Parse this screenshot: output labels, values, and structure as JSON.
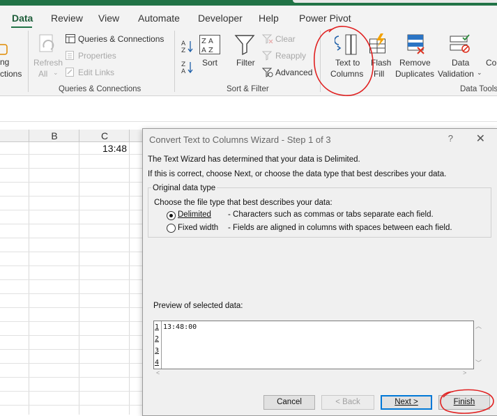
{
  "tabs": [
    "Data",
    "Review",
    "View",
    "Automate",
    "Developer",
    "Help",
    "Power Pivot"
  ],
  "ribbon": {
    "partial_left": {
      "line1": "ng",
      "line2": "ctions"
    },
    "refresh": {
      "line1": "Refresh",
      "line2": "All"
    },
    "queries_connections": "Queries & Connections",
    "properties": "Properties",
    "edit_links": "Edit Links",
    "group_queries": "Queries & Connections",
    "sort": "Sort",
    "filter": "Filter",
    "clear": "Clear",
    "reapply": "Reapply",
    "advanced": "Advanced",
    "group_sort_filter": "Sort & Filter",
    "text_to_columns": {
      "line1": "Text to",
      "line2": "Columns"
    },
    "flash_fill": {
      "line1": "Flash",
      "line2": "Fill"
    },
    "remove_duplicates": {
      "line1": "Remove",
      "line2": "Duplicates"
    },
    "data_validation": {
      "line1": "Data",
      "line2": "Validation"
    },
    "partial_right": "Co",
    "group_data_tools": "Data Tools"
  },
  "sheet": {
    "columns": [
      "B",
      "C"
    ],
    "cell_c1": "13:48"
  },
  "dialog": {
    "title": "Convert Text to Columns Wizard - Step 1 of 3",
    "help": "?",
    "close": "✕",
    "line1": "The Text Wizard has determined that your data is Delimited.",
    "line2": "If this is correct, choose Next, or choose the data type that best describes your data.",
    "group_label": "Original data type",
    "choose_text": "Choose the file type that best describes your data:",
    "options": [
      {
        "label": "Delimited",
        "desc": "- Characters such as commas or tabs separate each field.",
        "selected": true
      },
      {
        "label": "Fixed width",
        "desc": "- Fields are aligned in columns with spaces between each field.",
        "selected": false
      }
    ],
    "preview_label": "Preview of selected data:",
    "preview_rows": [
      "1",
      "2",
      "3",
      "4"
    ],
    "preview_line1": "13:48:00",
    "buttons": {
      "cancel": "Cancel",
      "back": "< Back",
      "next": "Next >",
      "finish": "Finish"
    }
  },
  "annotation_color": "#e02020"
}
